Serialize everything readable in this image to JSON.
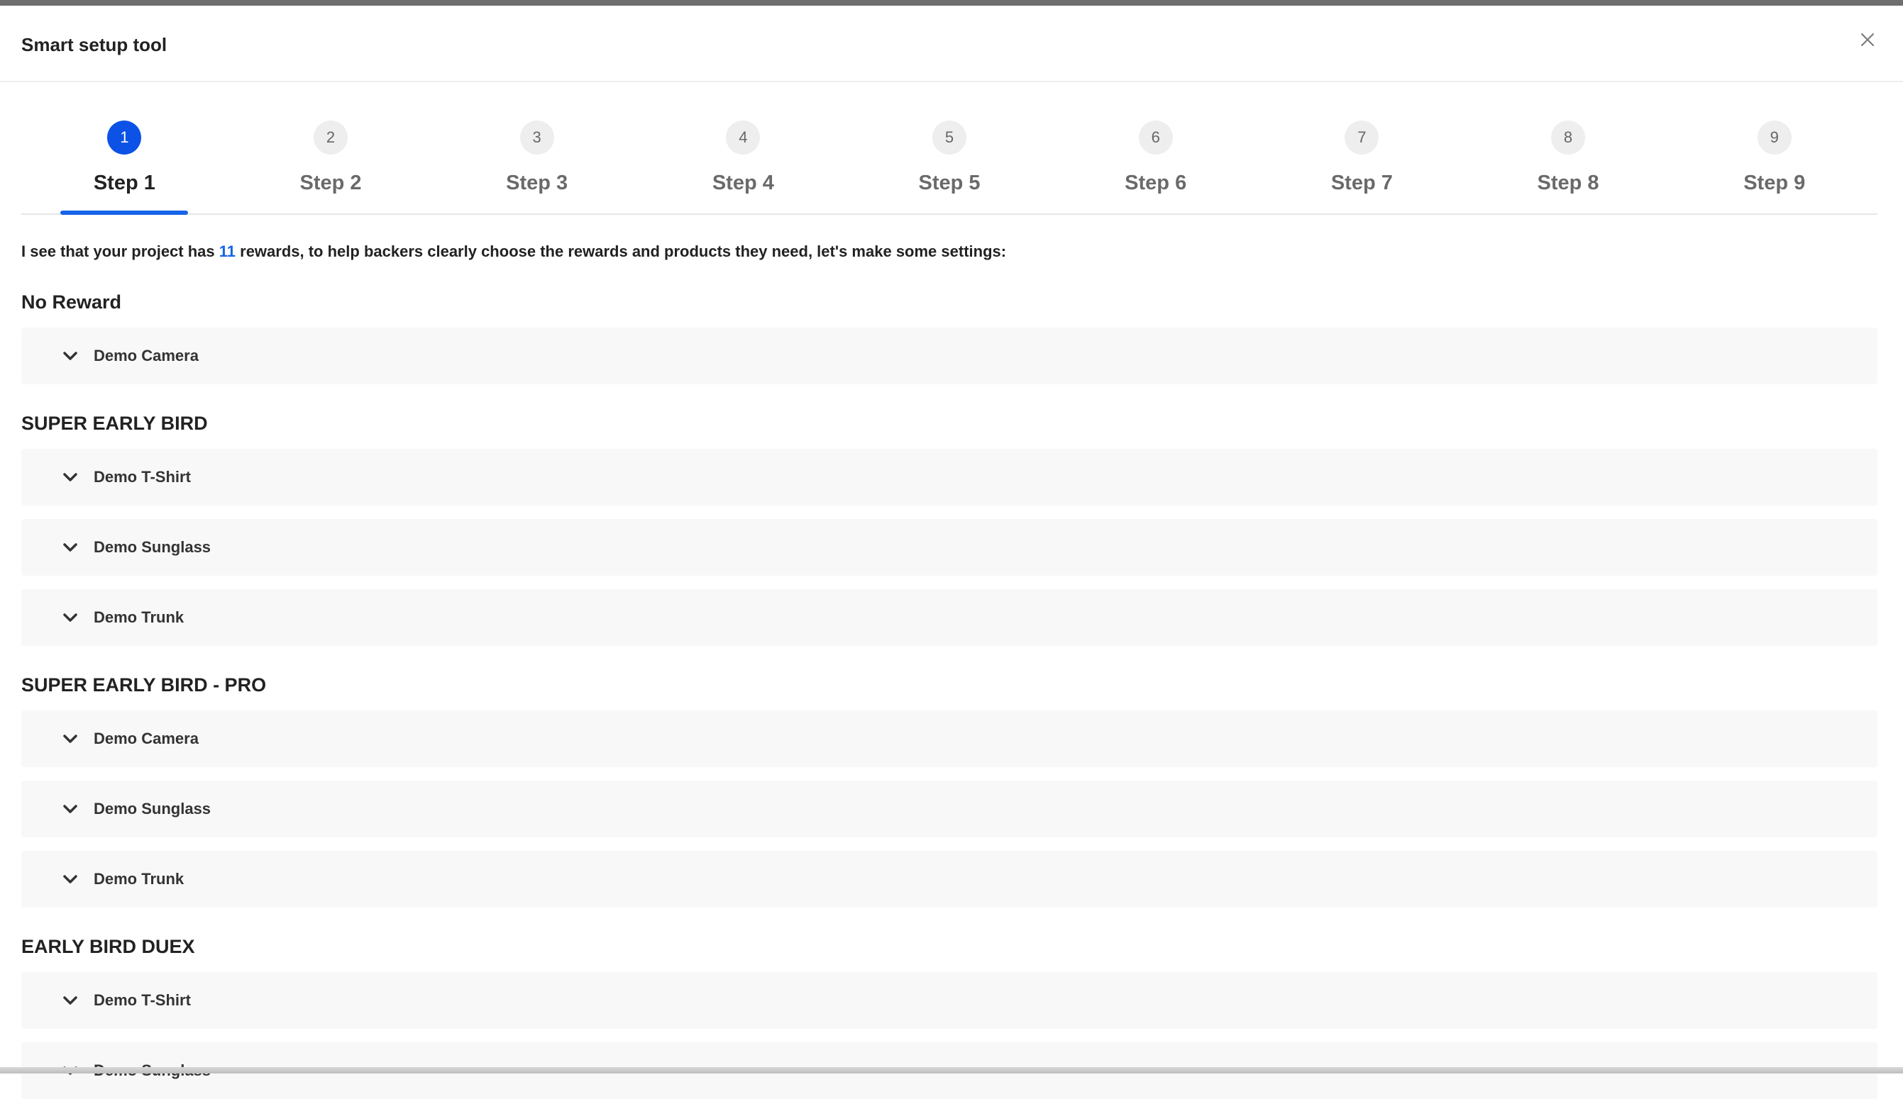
{
  "dialog": {
    "title": "Smart setup tool"
  },
  "steps": [
    {
      "number": "1",
      "label": "Step 1",
      "active": true
    },
    {
      "number": "2",
      "label": "Step 2"
    },
    {
      "number": "3",
      "label": "Step 3"
    },
    {
      "number": "4",
      "label": "Step 4"
    },
    {
      "number": "5",
      "label": "Step 5"
    },
    {
      "number": "6",
      "label": "Step 6"
    },
    {
      "number": "7",
      "label": "Step 7"
    },
    {
      "number": "8",
      "label": "Step 8"
    },
    {
      "number": "9",
      "label": "Step 9"
    }
  ],
  "intro": {
    "prefix": "I see that your project has ",
    "count": "11",
    "suffix": " rewards, to help backers clearly choose the rewards and products they need, let's make some settings:"
  },
  "groups": [
    {
      "title": "No Reward",
      "items": [
        "Demo Camera"
      ]
    },
    {
      "title": "SUPER EARLY BIRD",
      "items": [
        "Demo T-Shirt",
        "Demo Sunglass",
        "Demo Trunk"
      ]
    },
    {
      "title": "SUPER EARLY BIRD - PRO",
      "items": [
        "Demo Camera",
        "Demo Sunglass",
        "Demo Trunk"
      ]
    },
    {
      "title": "EARLY BIRD DUEX",
      "items": [
        "Demo T-Shirt",
        "Demo Sunglass"
      ]
    }
  ],
  "colors": {
    "accent": "#1565e8",
    "active_step": "#0c52e6",
    "item_bg": "#f8f8f8"
  },
  "icons": {
    "close": "close-icon",
    "expand": "chevron-down-icon"
  }
}
